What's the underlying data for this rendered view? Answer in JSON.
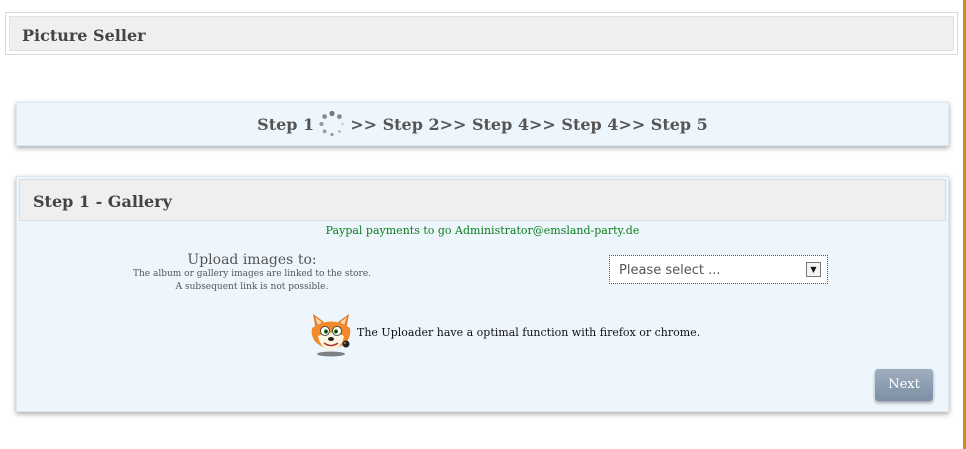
{
  "app": {
    "title": "Picture Seller"
  },
  "steps": {
    "items": [
      "Step 1",
      ">> Step 2",
      ">> Step 4",
      ">> Step 4",
      ">> Step 5"
    ],
    "loading_icon": "spinner-icon"
  },
  "panel": {
    "title": "Step 1 - Gallery",
    "paypal_note": "Paypal payments to go Administrator@emsland-party.de",
    "upload": {
      "label": "Upload images to:",
      "hint_line1": "The album or gallery images are linked to the store.",
      "hint_line2": "A subsequent link is not possible."
    },
    "select": {
      "value": "Please select ...",
      "arrow_icon": "chevron-down-icon"
    },
    "browser_note": "The Uploader have a optimal function with firefox or chrome.",
    "mascot_icon": "fox-icon",
    "next_label": "Next"
  },
  "colors": {
    "panel_bg": "#eef6fd",
    "header_bg": "#efefef",
    "paypal_text": "#0b7d1b",
    "button_bg": "#8c9fb3",
    "accent_edge": "#d08a2a"
  }
}
